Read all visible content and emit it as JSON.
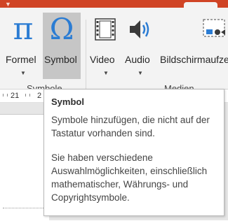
{
  "colors": {
    "title_bar": "#d04425",
    "ribbon_bg": "#f3f3f3",
    "active_button_bg": "#c6c6c6",
    "icon_blue": "#2b7cd3"
  },
  "ribbon": {
    "buttons": [
      {
        "label": "Formel",
        "icon": "pi-icon",
        "glyph": "π",
        "has_dropdown": true
      },
      {
        "label": "Symbol",
        "icon": "omega-icon",
        "glyph": "Ω",
        "has_dropdown": false,
        "active": true
      },
      {
        "label": "Video",
        "icon": "film-icon",
        "has_dropdown": true
      },
      {
        "label": "Audio",
        "icon": "speaker-icon",
        "has_dropdown": true
      },
      {
        "label": "Bildschirmaufze",
        "icon": "screen-recording-icon",
        "has_dropdown": false
      }
    ],
    "groups": {
      "symbols": "Symbole",
      "media": "Medien"
    }
  },
  "ruler": {
    "numbers": [
      "21",
      "2"
    ]
  },
  "tooltip": {
    "title": "Symbol",
    "paragraph1": "Symbole hinzufügen, die nicht auf der Tastatur vorhanden sind.",
    "paragraph2": "Sie haben verschiedene Auswahlmöglichkeiten, einschließlich mathematischer, Währungs- und Copyrightsymbole."
  }
}
